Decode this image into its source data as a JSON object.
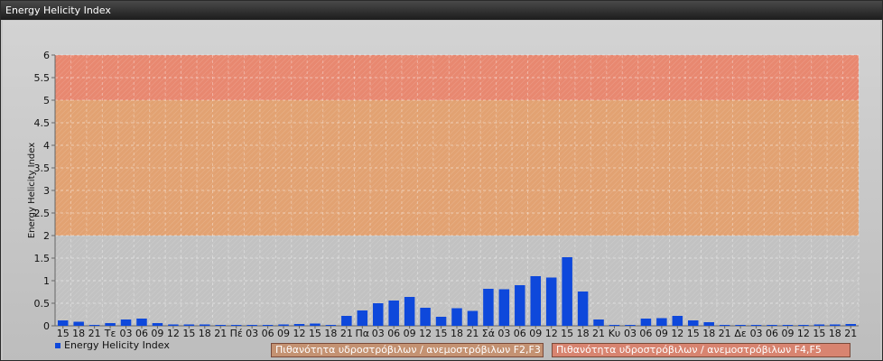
{
  "window": {
    "title": "Energy Helicity Index"
  },
  "legend": {
    "series_label": "Energy Helicity Index",
    "zone1_label": "Πιθανότητα υδροστρόβιλων / ανεμοστρόβιλων F2,F3",
    "zone2_label": "Πιθανότητα υδροστρόβιλων / ανεμοστρόβιλων F4,F5"
  },
  "colors": {
    "bar": "#0e48db",
    "zone_low": "#c2c2c2",
    "zone_mid": "#e2a272",
    "zone_high": "#e88870",
    "zone1_box": "#c49272",
    "zone2_box": "#d88470"
  },
  "chart_data": {
    "type": "bar",
    "title": "",
    "ylabel": "Energy Helicity Index",
    "xlabel": "",
    "ylim": [
      0,
      6
    ],
    "yticks": [
      "0",
      "0.5",
      "1",
      "1.5",
      "2",
      "2.5",
      "3",
      "3.5",
      "4",
      "4.5",
      "5",
      "5.5",
      "6"
    ],
    "grid": true,
    "legend_position": "bottom-left",
    "bands": [
      {
        "from": 0,
        "to": 2,
        "color": "#c2c2c2"
      },
      {
        "from": 2,
        "to": 5,
        "color": "#e2a272"
      },
      {
        "from": 5,
        "to": 6,
        "color": "#e88870"
      }
    ],
    "categories": [
      "15",
      "18",
      "21",
      "Τε",
      "03",
      "06",
      "09",
      "12",
      "15",
      "18",
      "21",
      "Πέ",
      "03",
      "06",
      "09",
      "12",
      "15",
      "18",
      "21",
      "Πα",
      "03",
      "06",
      "09",
      "12",
      "15",
      "18",
      "21",
      "Σά",
      "03",
      "06",
      "09",
      "12",
      "15",
      "18",
      "21",
      "Κυ",
      "03",
      "06",
      "09",
      "12",
      "15",
      "18",
      "21",
      "Δε",
      "03",
      "06",
      "09",
      "12",
      "15",
      "18",
      "21"
    ],
    "series": [
      {
        "name": "Energy Helicity Index",
        "values": [
          0.12,
          0.09,
          0.02,
          0.06,
          0.14,
          0.16,
          0.06,
          0.03,
          0.03,
          0.03,
          0.02,
          0.02,
          0.02,
          0.02,
          0.03,
          0.04,
          0.05,
          0.02,
          0.22,
          0.34,
          0.5,
          0.56,
          0.64,
          0.4,
          0.2,
          0.39,
          0.33,
          0.82,
          0.81,
          0.9,
          1.1,
          1.07,
          1.52,
          0.76,
          0.14,
          0.02,
          0.02,
          0.16,
          0.17,
          0.22,
          0.12,
          0.08,
          0.02,
          0.02,
          0.02,
          0.02,
          0.02,
          0.02,
          0.03,
          0.03,
          0.04
        ]
      }
    ]
  }
}
